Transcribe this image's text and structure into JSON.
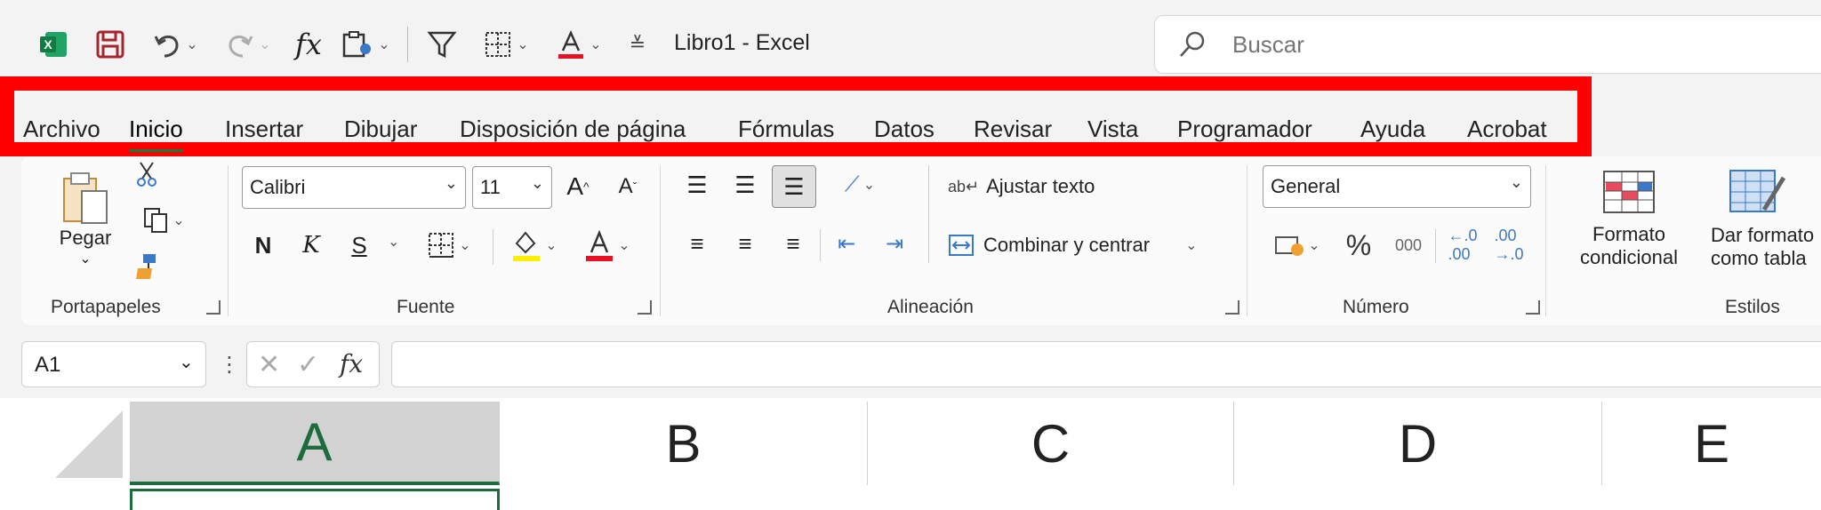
{
  "window": {
    "title": "Libro1 - Excel"
  },
  "search": {
    "placeholder": "Buscar"
  },
  "menu": {
    "tabs": [
      {
        "label": "Archivo"
      },
      {
        "label": "Inicio"
      },
      {
        "label": "Insertar"
      },
      {
        "label": "Dibujar"
      },
      {
        "label": "Disposición de página"
      },
      {
        "label": "Fórmulas"
      },
      {
        "label": "Datos"
      },
      {
        "label": "Revisar"
      },
      {
        "label": "Vista"
      },
      {
        "label": "Programador"
      },
      {
        "label": "Ayuda"
      },
      {
        "label": "Acrobat"
      }
    ],
    "active_tab": "Inicio"
  },
  "ribbon": {
    "clipboard": {
      "paste_label": "Pegar",
      "group_label": "Portapapeles"
    },
    "font": {
      "font_name": "Calibri",
      "font_size": "11",
      "bold": "N",
      "italic": "K",
      "underline": "S",
      "group_label": "Fuente"
    },
    "alignment": {
      "wrap_text": "Ajustar texto",
      "merge_center": "Combinar y centrar",
      "group_label": "Alineación"
    },
    "number": {
      "format": "General",
      "percent": "%",
      "thousands": "000",
      "group_label": "Número"
    },
    "styles": {
      "conditional_format_line1": "Formato",
      "conditional_format_line2": "condicional",
      "format_table_line1": "Dar formato",
      "format_table_line2": "como tabla",
      "group_label": "Estilos"
    }
  },
  "formula_bar": {
    "name_box": "A1",
    "formula": ""
  },
  "grid": {
    "columns": [
      "A",
      "B",
      "C",
      "D",
      "E"
    ],
    "selected_column": "A"
  },
  "colors": {
    "excel_green": "#107c41",
    "highlight_box": "#ff0000",
    "font_color_bar": "#e81123",
    "highlight_yellow": "#ffee00"
  }
}
